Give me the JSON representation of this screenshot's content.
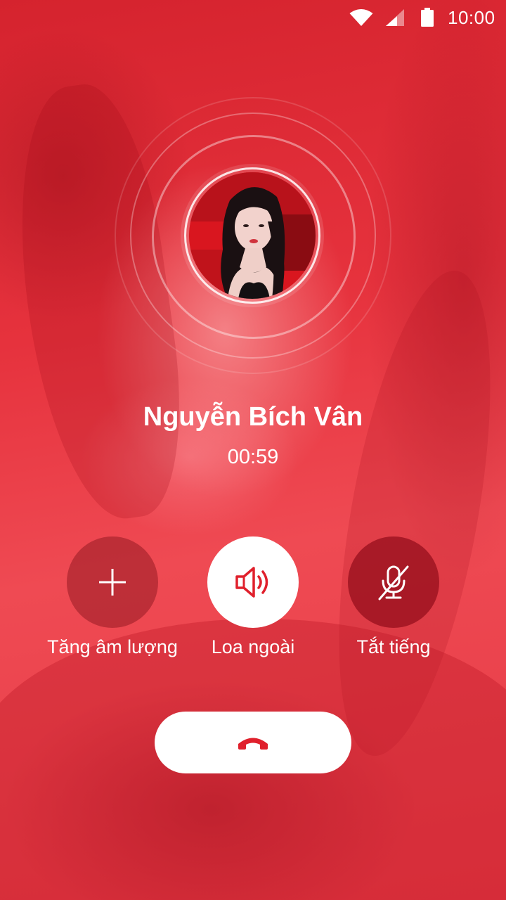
{
  "status_bar": {
    "time": "10:00",
    "icons": [
      "wifi-icon",
      "signal-icon",
      "battery-icon"
    ]
  },
  "caller": {
    "name": "Nguyễn Bích Vân",
    "duration": "00:59"
  },
  "actions": {
    "volume_up": {
      "label": "Tăng âm lượng",
      "icon": "plus-icon"
    },
    "speaker": {
      "label": "Loa ngoài",
      "icon": "speaker-icon"
    },
    "mute": {
      "label": "Tắt tiếng",
      "icon": "mic-off-icon"
    }
  },
  "end_call": {
    "icon": "phone-hangup-icon"
  },
  "colors": {
    "primary_red": "#e8323d",
    "icon_red": "#e0202c",
    "white": "#ffffff"
  }
}
